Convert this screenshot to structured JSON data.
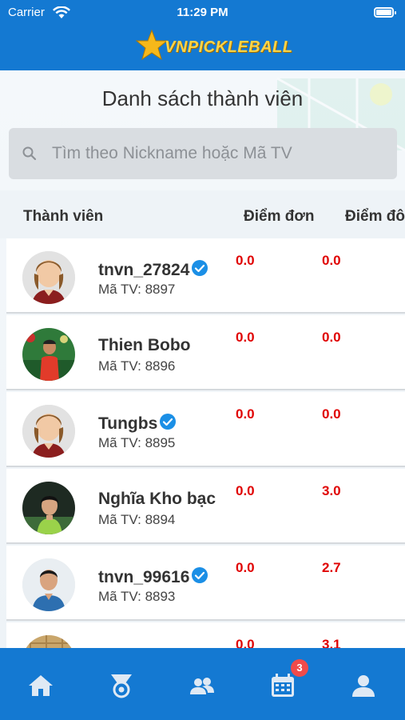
{
  "status_bar": {
    "carrier": "Carrier",
    "time": "11:29 PM"
  },
  "brand": {
    "logo_text": "VNPICKLEBALL"
  },
  "page": {
    "title": "Danh sách thành viên"
  },
  "search": {
    "placeholder": "Tìm theo Nickname hoặc Mã TV"
  },
  "table": {
    "headers": {
      "member": "Thành viên",
      "single_score": "Điểm đơn",
      "double_score": "Điểm đôi"
    },
    "rows": [
      {
        "name": "tnvn_27824",
        "code": "Mã TV: 8897",
        "single": "0.0",
        "double": "0.0"
      },
      {
        "name": "Thien Bobo",
        "code": "Mã TV: 8896",
        "single": "0.0",
        "double": "0.0"
      },
      {
        "name": "Tungbs",
        "code": "Mã TV: 8895",
        "single": "0.0",
        "double": "0.0"
      },
      {
        "name": "Nghĩa Kho bạc",
        "code": "Mã TV: 8894",
        "single": "0.0",
        "double": "3.0"
      },
      {
        "name": "tnvn_99616",
        "code": "Mã TV: 8893",
        "single": "0.0",
        "double": "2.7"
      },
      {
        "name": "",
        "code": "",
        "single": "0.0",
        "double": "3.1"
      }
    ]
  },
  "tab_bar": {
    "tabs": [
      {
        "icon": "home-icon"
      },
      {
        "icon": "medal-icon"
      },
      {
        "icon": "members-icon"
      },
      {
        "icon": "calendar-icon",
        "badge": "3"
      },
      {
        "icon": "profile-icon"
      }
    ]
  },
  "colors": {
    "brand_blue": "#1479d2",
    "score_red": "#e00000",
    "badge_red": "#f04b4b",
    "verified_blue": "#1b8fe6"
  }
}
